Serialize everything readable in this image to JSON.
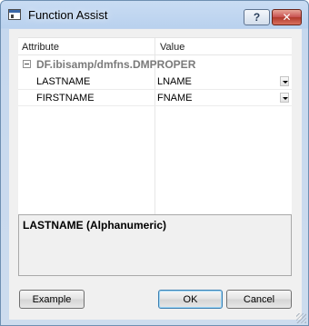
{
  "window": {
    "title": "Function Assist",
    "help_label": "?",
    "close_label": "✕"
  },
  "grid": {
    "columns": [
      "Attribute",
      "Value"
    ],
    "group": "DF.ibisamp/dmfns.DMPROPER",
    "rows": [
      {
        "attribute": "LASTNAME",
        "value": "LNAME"
      },
      {
        "attribute": "FIRSTNAME",
        "value": "FNAME"
      }
    ]
  },
  "description": "LASTNAME (Alphanumeric)",
  "buttons": {
    "example": "Example",
    "ok": "OK",
    "cancel": "Cancel"
  },
  "icons": {
    "app": "window-icon",
    "help": "help-icon",
    "close": "close-icon",
    "collapse": "minus-icon",
    "dropdown": "chevron-down-icon"
  }
}
